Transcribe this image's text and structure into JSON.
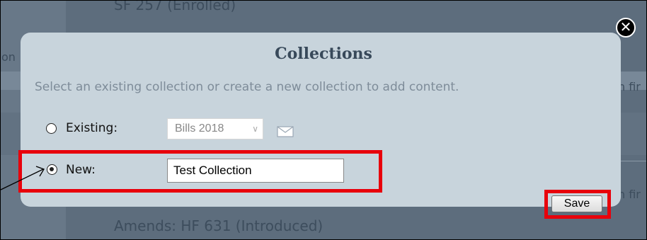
{
  "background": {
    "top_text": "SF 257 (Enrolled)",
    "bottom_text": "Amends: HF 631 (Introduced)",
    "left_fragment": "on",
    "right_fragment_1": "n fir",
    "right_fragment_2": "n fir"
  },
  "dialog": {
    "title": "Collections",
    "description": "Select an existing collection or create a new collection to add content.",
    "close_symbol": "✕",
    "existing": {
      "label": "Existing:",
      "checked": false,
      "selected_collection": "Bills 2018"
    },
    "new": {
      "label": "New:",
      "checked": true,
      "value": "Test Collection"
    },
    "save_label": "Save"
  },
  "colors": {
    "highlight": "#e8000b",
    "modal_bg": "#c8d4dc",
    "title": "#38495a"
  }
}
